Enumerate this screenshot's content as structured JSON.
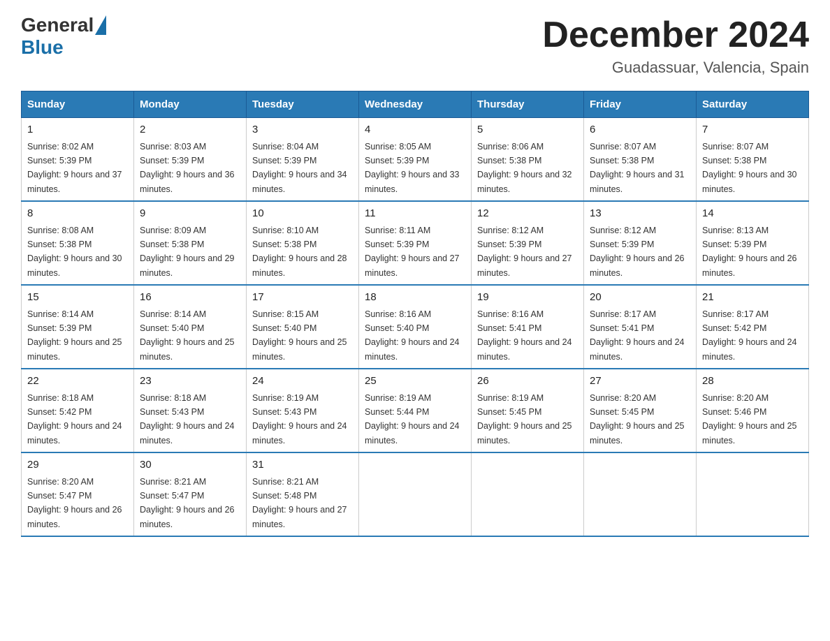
{
  "header": {
    "logo_text_general": "General",
    "logo_text_blue": "Blue",
    "title": "December 2024",
    "location": "Guadassuar, Valencia, Spain"
  },
  "calendar": {
    "days_of_week": [
      "Sunday",
      "Monday",
      "Tuesday",
      "Wednesday",
      "Thursday",
      "Friday",
      "Saturday"
    ],
    "weeks": [
      [
        {
          "day": "1",
          "sunrise": "8:02 AM",
          "sunset": "5:39 PM",
          "daylight": "9 hours and 37 minutes."
        },
        {
          "day": "2",
          "sunrise": "8:03 AM",
          "sunset": "5:39 PM",
          "daylight": "9 hours and 36 minutes."
        },
        {
          "day": "3",
          "sunrise": "8:04 AM",
          "sunset": "5:39 PM",
          "daylight": "9 hours and 34 minutes."
        },
        {
          "day": "4",
          "sunrise": "8:05 AM",
          "sunset": "5:39 PM",
          "daylight": "9 hours and 33 minutes."
        },
        {
          "day": "5",
          "sunrise": "8:06 AM",
          "sunset": "5:38 PM",
          "daylight": "9 hours and 32 minutes."
        },
        {
          "day": "6",
          "sunrise": "8:07 AM",
          "sunset": "5:38 PM",
          "daylight": "9 hours and 31 minutes."
        },
        {
          "day": "7",
          "sunrise": "8:07 AM",
          "sunset": "5:38 PM",
          "daylight": "9 hours and 30 minutes."
        }
      ],
      [
        {
          "day": "8",
          "sunrise": "8:08 AM",
          "sunset": "5:38 PM",
          "daylight": "9 hours and 30 minutes."
        },
        {
          "day": "9",
          "sunrise": "8:09 AM",
          "sunset": "5:38 PM",
          "daylight": "9 hours and 29 minutes."
        },
        {
          "day": "10",
          "sunrise": "8:10 AM",
          "sunset": "5:38 PM",
          "daylight": "9 hours and 28 minutes."
        },
        {
          "day": "11",
          "sunrise": "8:11 AM",
          "sunset": "5:39 PM",
          "daylight": "9 hours and 27 minutes."
        },
        {
          "day": "12",
          "sunrise": "8:12 AM",
          "sunset": "5:39 PM",
          "daylight": "9 hours and 27 minutes."
        },
        {
          "day": "13",
          "sunrise": "8:12 AM",
          "sunset": "5:39 PM",
          "daylight": "9 hours and 26 minutes."
        },
        {
          "day": "14",
          "sunrise": "8:13 AM",
          "sunset": "5:39 PM",
          "daylight": "9 hours and 26 minutes."
        }
      ],
      [
        {
          "day": "15",
          "sunrise": "8:14 AM",
          "sunset": "5:39 PM",
          "daylight": "9 hours and 25 minutes."
        },
        {
          "day": "16",
          "sunrise": "8:14 AM",
          "sunset": "5:40 PM",
          "daylight": "9 hours and 25 minutes."
        },
        {
          "day": "17",
          "sunrise": "8:15 AM",
          "sunset": "5:40 PM",
          "daylight": "9 hours and 25 minutes."
        },
        {
          "day": "18",
          "sunrise": "8:16 AM",
          "sunset": "5:40 PM",
          "daylight": "9 hours and 24 minutes."
        },
        {
          "day": "19",
          "sunrise": "8:16 AM",
          "sunset": "5:41 PM",
          "daylight": "9 hours and 24 minutes."
        },
        {
          "day": "20",
          "sunrise": "8:17 AM",
          "sunset": "5:41 PM",
          "daylight": "9 hours and 24 minutes."
        },
        {
          "day": "21",
          "sunrise": "8:17 AM",
          "sunset": "5:42 PM",
          "daylight": "9 hours and 24 minutes."
        }
      ],
      [
        {
          "day": "22",
          "sunrise": "8:18 AM",
          "sunset": "5:42 PM",
          "daylight": "9 hours and 24 minutes."
        },
        {
          "day": "23",
          "sunrise": "8:18 AM",
          "sunset": "5:43 PM",
          "daylight": "9 hours and 24 minutes."
        },
        {
          "day": "24",
          "sunrise": "8:19 AM",
          "sunset": "5:43 PM",
          "daylight": "9 hours and 24 minutes."
        },
        {
          "day": "25",
          "sunrise": "8:19 AM",
          "sunset": "5:44 PM",
          "daylight": "9 hours and 24 minutes."
        },
        {
          "day": "26",
          "sunrise": "8:19 AM",
          "sunset": "5:45 PM",
          "daylight": "9 hours and 25 minutes."
        },
        {
          "day": "27",
          "sunrise": "8:20 AM",
          "sunset": "5:45 PM",
          "daylight": "9 hours and 25 minutes."
        },
        {
          "day": "28",
          "sunrise": "8:20 AM",
          "sunset": "5:46 PM",
          "daylight": "9 hours and 25 minutes."
        }
      ],
      [
        {
          "day": "29",
          "sunrise": "8:20 AM",
          "sunset": "5:47 PM",
          "daylight": "9 hours and 26 minutes."
        },
        {
          "day": "30",
          "sunrise": "8:21 AM",
          "sunset": "5:47 PM",
          "daylight": "9 hours and 26 minutes."
        },
        {
          "day": "31",
          "sunrise": "8:21 AM",
          "sunset": "5:48 PM",
          "daylight": "9 hours and 27 minutes."
        },
        null,
        null,
        null,
        null
      ]
    ]
  }
}
